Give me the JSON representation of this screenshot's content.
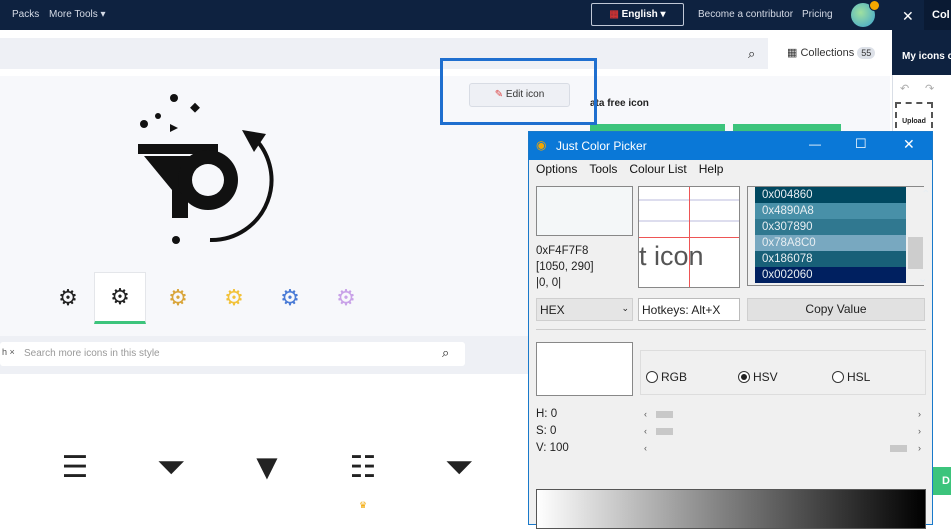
{
  "topbar": {
    "packs": "Packs",
    "more_tools": "More Tools",
    "language": "English",
    "contributor": "Become a contributor",
    "pricing": "Pricing"
  },
  "right_panel": {
    "title": "Col",
    "my_icons": "My icons c",
    "upload": "Upload",
    "download_partial": "D"
  },
  "search": {
    "collections": "Collections",
    "collections_count": "55"
  },
  "icon_detail": {
    "edit_label": "Edit icon",
    "title_partial": "ata free icon"
  },
  "style_search": {
    "tag": "h",
    "placeholder": "Search more icons in this style"
  },
  "color_picker": {
    "title": "Just Color Picker",
    "menu": [
      "Options",
      "Tools",
      "Colour List",
      "Help"
    ],
    "current_hex": "0xF4F7F8",
    "coords": "[1050, 290]",
    "offset": "|0, 0|",
    "zoom_text": "t icon",
    "colour_list": [
      {
        "value": "0x004860",
        "color": "#004860"
      },
      {
        "value": "0x4890A8",
        "color": "#4890A8"
      },
      {
        "value": "0x307890",
        "color": "#307890"
      },
      {
        "value": "0x78A8C0",
        "color": "#78A8C0"
      },
      {
        "value": "0x186078",
        "color": "#186078"
      },
      {
        "value": "0x002060",
        "color": "#002060"
      }
    ],
    "format": "HEX",
    "hotkeys": "Hotkeys: Alt+X",
    "copy": "Copy Value",
    "modes": [
      "RGB",
      "HSV",
      "HSL"
    ],
    "selected_mode": "HSV",
    "h": "H: 0",
    "s": "S: 0",
    "v": "V: 100"
  },
  "colors": {
    "accent": "#0a78d7",
    "navy": "#0e2240",
    "green": "#3cc47c",
    "highlight": "#1f6fcf"
  }
}
